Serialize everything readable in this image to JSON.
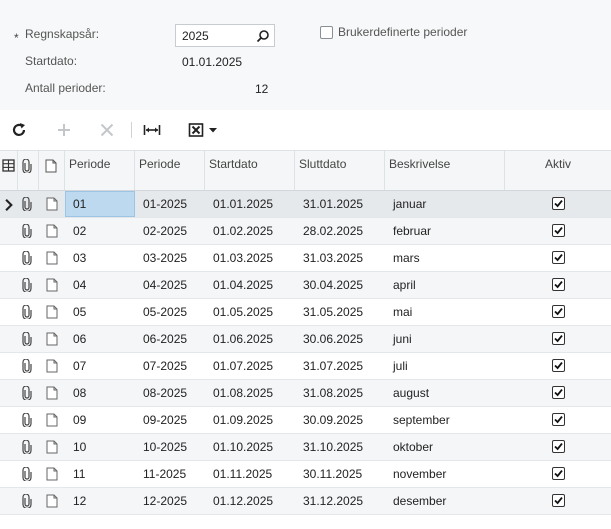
{
  "form": {
    "required_mark": "*",
    "fiscal_year_label": "Regnskapsår:",
    "fiscal_year_value": "2025",
    "start_date_label": "Startdato:",
    "start_date_value": "01.01.2025",
    "periods_count_label": "Antall perioder:",
    "periods_count_value": "12",
    "custom_periods_label": "Brukerdefinerte perioder",
    "custom_periods_checked": false
  },
  "toolbar": {
    "icons": [
      "refresh-icon",
      "add-icon",
      "delete-icon",
      "fit-columns-icon",
      "excel-export-icon"
    ]
  },
  "grid": {
    "headers": [
      "Periode",
      "Periode",
      "Startdato",
      "Sluttdato",
      "Beskrivelse",
      "Aktiv"
    ],
    "rows": [
      {
        "period": "01",
        "period_id": "01-2025",
        "start": "01.01.2025",
        "end": "31.01.2025",
        "description": "januar",
        "active": true
      },
      {
        "period": "02",
        "period_id": "02-2025",
        "start": "01.02.2025",
        "end": "28.02.2025",
        "description": "februar",
        "active": true
      },
      {
        "period": "03",
        "period_id": "03-2025",
        "start": "01.03.2025",
        "end": "31.03.2025",
        "description": "mars",
        "active": true
      },
      {
        "period": "04",
        "period_id": "04-2025",
        "start": "01.04.2025",
        "end": "30.04.2025",
        "description": "april",
        "active": true
      },
      {
        "period": "05",
        "period_id": "05-2025",
        "start": "01.05.2025",
        "end": "31.05.2025",
        "description": "mai",
        "active": true
      },
      {
        "period": "06",
        "period_id": "06-2025",
        "start": "01.06.2025",
        "end": "30.06.2025",
        "description": "juni",
        "active": true
      },
      {
        "period": "07",
        "period_id": "07-2025",
        "start": "01.07.2025",
        "end": "31.07.2025",
        "description": "juli",
        "active": true
      },
      {
        "period": "08",
        "period_id": "08-2025",
        "start": "01.08.2025",
        "end": "31.08.2025",
        "description": "august",
        "active": true
      },
      {
        "period": "09",
        "period_id": "09-2025",
        "start": "01.09.2025",
        "end": "30.09.2025",
        "description": "september",
        "active": true
      },
      {
        "period": "10",
        "period_id": "10-2025",
        "start": "01.10.2025",
        "end": "31.10.2025",
        "description": "oktober",
        "active": true
      },
      {
        "period": "11",
        "period_id": "11-2025",
        "start": "01.11.2025",
        "end": "30.11.2025",
        "description": "november",
        "active": true
      },
      {
        "period": "12",
        "period_id": "12-2025",
        "start": "01.12.2025",
        "end": "31.12.2025",
        "description": "desember",
        "active": true
      }
    ]
  }
}
